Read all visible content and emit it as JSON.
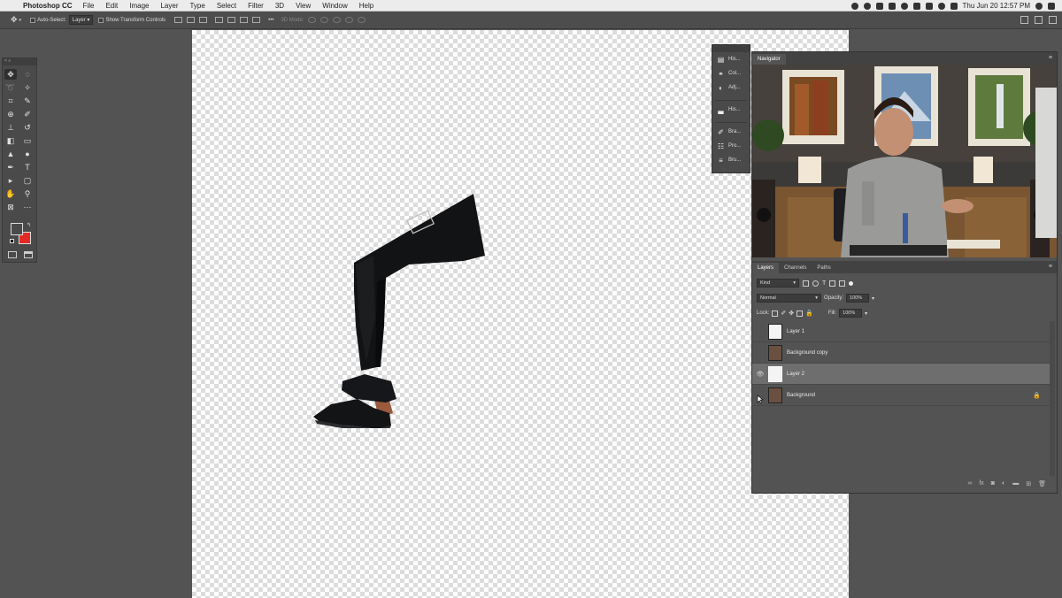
{
  "menubar": {
    "app_name": "Photoshop CC",
    "items": [
      "File",
      "Edit",
      "Image",
      "Layer",
      "Type",
      "Select",
      "Filter",
      "3D",
      "View",
      "Window",
      "Help"
    ],
    "clock": "Thu Jun 20  12:57 PM"
  },
  "options": {
    "auto_select_label": "Auto-Select:",
    "auto_select_value": "Layer",
    "transform_label": "Show Transform Controls",
    "threed_label": "3D Mode:"
  },
  "dock": {
    "items": [
      "His...",
      "Col...",
      "Adj...",
      "His...",
      "Bra...",
      "Pro...",
      "Bru..."
    ]
  },
  "navigator": {
    "tab_label": "Navigator"
  },
  "layers_panel": {
    "tabs": [
      "Layers",
      "Channels",
      "Paths"
    ],
    "filter_value": "Kind",
    "blend_mode": "Normal",
    "opacity_label": "Opacity:",
    "opacity_value": "100%",
    "lock_label": "Lock:",
    "fill_label": "Fill:",
    "fill_value": "100%",
    "layers": [
      {
        "name": "Layer 1",
        "visible": false,
        "selected": false
      },
      {
        "name": "Background copy",
        "visible": false,
        "selected": false
      },
      {
        "name": "Layer 2",
        "visible": true,
        "selected": true
      },
      {
        "name": "Background",
        "visible": false,
        "selected": false
      }
    ]
  },
  "colors": {
    "foreground": "#4a4a4a",
    "background": "#e22b24",
    "canvas_check": "#dcdcdc"
  }
}
